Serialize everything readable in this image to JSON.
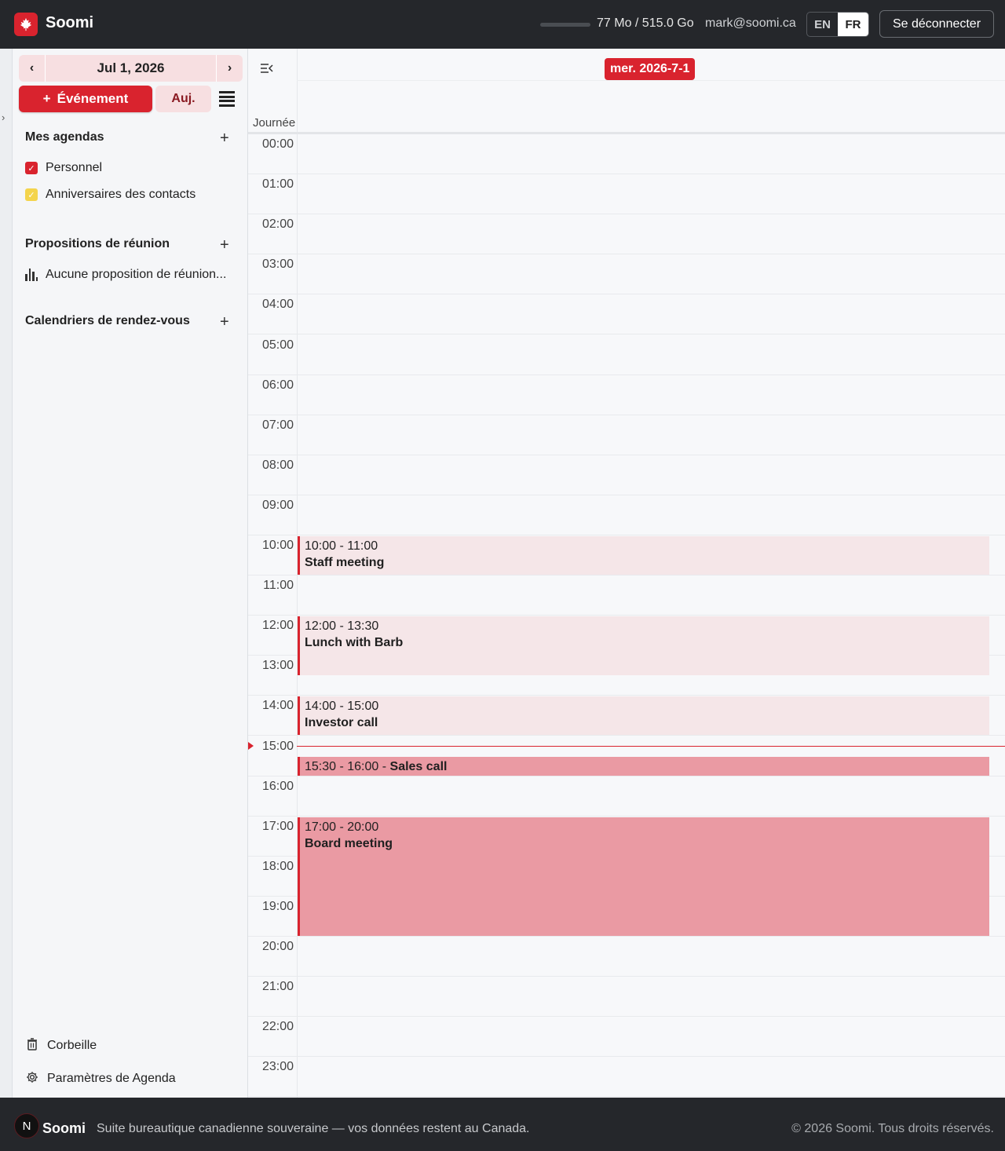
{
  "header": {
    "brand": "Soomi",
    "logo_icon": "maple-leaf-icon",
    "quota_text": "77 Mo / 515.0 Go",
    "user_email": "mark@soomi.ca",
    "languages": [
      "EN",
      "FR"
    ],
    "active_language": "FR",
    "logout_label": "Se déconnecter"
  },
  "sidebar": {
    "toggle_glyph": "›",
    "date_label": "Jul 1, 2026",
    "prev_glyph": "‹",
    "next_glyph": "›",
    "new_event_label": "Événement",
    "new_event_icon": "+",
    "today_label": "Auj.",
    "my_calendars_title": "Mes agendas",
    "add_glyph": "+",
    "calendars": [
      {
        "label": "Personnel",
        "color": "#d9232e",
        "checked": true
      },
      {
        "label": "Anniversaires des contacts",
        "color": "#f4d44c",
        "checked": true
      }
    ],
    "meeting_proposals_title": "Propositions de réunion",
    "no_proposals_label": "Aucune proposition de réunion...",
    "booking_calendars_title": "Calendriers de rendez-vous",
    "trash_label": "Corbeille",
    "settings_label": "Paramètres de Agenda"
  },
  "calendar": {
    "day_header": "mer. 2026-7-1",
    "allday_label": "Journée",
    "hours": [
      "00:00",
      "01:00",
      "02:00",
      "03:00",
      "04:00",
      "05:00",
      "06:00",
      "07:00",
      "08:00",
      "09:00",
      "10:00",
      "11:00",
      "12:00",
      "13:00",
      "14:00",
      "15:00",
      "16:00",
      "17:00",
      "18:00",
      "19:00",
      "20:00",
      "21:00",
      "22:00",
      "23:00"
    ],
    "now_time": "15:15",
    "events": [
      {
        "start": 10,
        "end": 11,
        "time": "10:00 - 11:00",
        "title": "Staff meeting",
        "style": "light",
        "inline": false
      },
      {
        "start": 12,
        "end": 13.5,
        "time": "12:00 - 13:30",
        "title": "Lunch with Barb",
        "style": "light",
        "inline": false
      },
      {
        "start": 14,
        "end": 15,
        "time": "14:00 - 15:00",
        "title": "Investor call",
        "style": "light",
        "inline": false
      },
      {
        "start": 15.5,
        "end": 16,
        "time": "15:30 - 16:00 - ",
        "title": "Sales call",
        "style": "strong",
        "inline": true
      },
      {
        "start": 17,
        "end": 20,
        "time": "17:00 - 20:00",
        "title": "Board meeting",
        "style": "strong",
        "inline": false
      }
    ]
  },
  "footer": {
    "logo_letter": "N",
    "brand": "Soomi",
    "tagline": "Suite bureautique canadienne souveraine — vos données restent au Canada.",
    "copyright": "© 2026 Soomi. Tous droits réservés."
  },
  "colors": {
    "accent": "#d9232e",
    "header_bg": "#25272b",
    "event_light": "#f5e6e8",
    "event_strong": "#ea9aa3"
  }
}
